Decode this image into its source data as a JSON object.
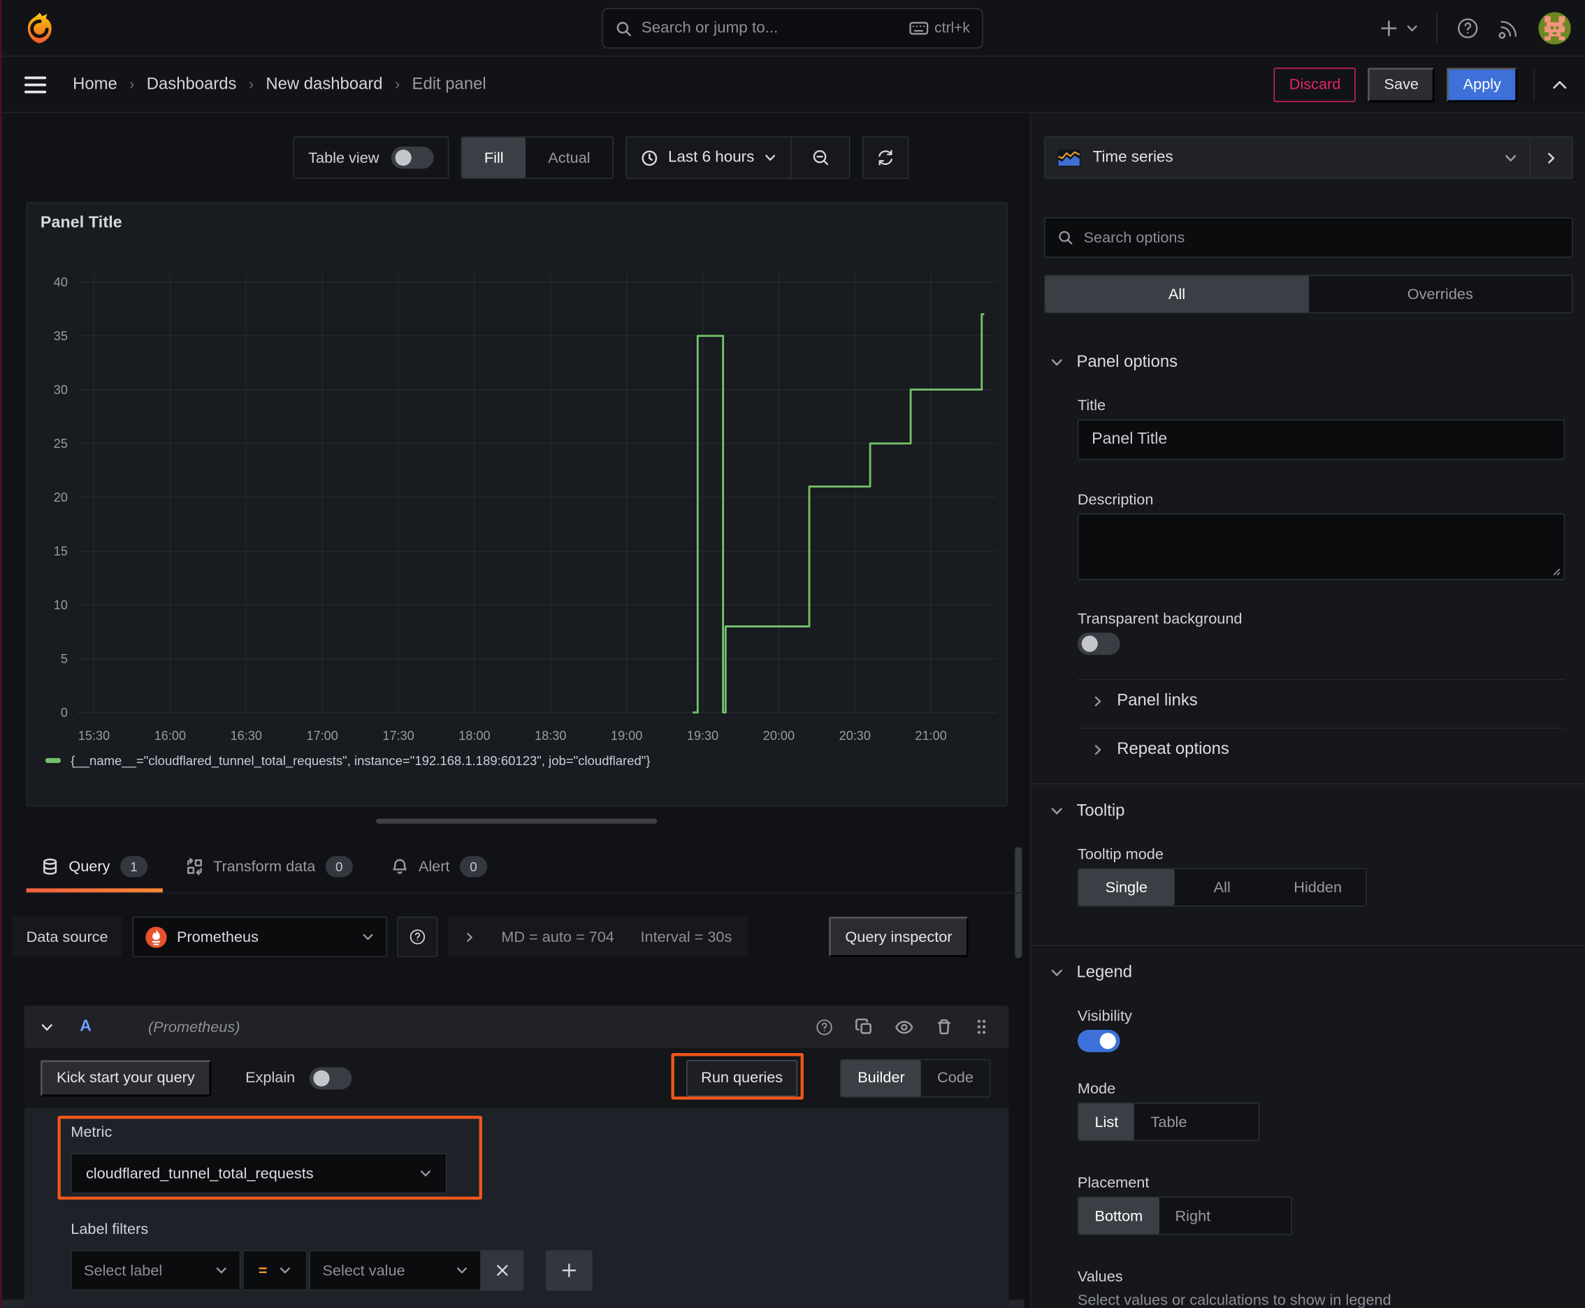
{
  "colors": {
    "primary_blue": "#3D71D9",
    "series_green": "#73BF69",
    "annotation_orange": "#F0571C",
    "discard_pink": "#E0226E",
    "operator_orange": "#FF9830"
  },
  "topbar": {
    "search_placeholder": "Search or jump to...",
    "search_shortcut": "ctrl+k"
  },
  "breadcrumb": {
    "home": "Home",
    "dashboards": "Dashboards",
    "dashboard": "New dashboard",
    "current": "Edit panel"
  },
  "header_actions": {
    "discard": "Discard",
    "save": "Save",
    "apply": "Apply"
  },
  "toolbar": {
    "table_view_label": "Table view",
    "display_modes": [
      "Fill",
      "Actual"
    ],
    "selected_display": "Fill",
    "time_range": "Last 6 hours"
  },
  "panel": {
    "title": "Panel Title"
  },
  "chart_data": {
    "type": "line",
    "style": "step-line",
    "title": "Panel Title",
    "series": [
      {
        "name": "{__name__=\"cloudflared_tunnel_total_requests\", instance=\"192.168.1.189:60123\", job=\"cloudflared\"}",
        "color": "#73BF69",
        "points": [
          [
            "19:26",
            0
          ],
          [
            "19:28",
            0
          ],
          [
            "19:28",
            35
          ],
          [
            "19:38",
            35
          ],
          [
            "19:38",
            0
          ],
          [
            "19:39",
            0
          ],
          [
            "19:39",
            8
          ],
          [
            "20:12",
            8
          ],
          [
            "20:12",
            21
          ],
          [
            "20:36",
            21
          ],
          [
            "20:36",
            25
          ],
          [
            "20:52",
            25
          ],
          [
            "20:52",
            30
          ],
          [
            "21:20",
            30
          ],
          [
            "21:20",
            37
          ],
          [
            "21:21",
            37
          ]
        ]
      }
    ],
    "x_ticks": [
      "15:30",
      "16:00",
      "16:30",
      "17:00",
      "17:30",
      "18:00",
      "18:30",
      "19:00",
      "19:30",
      "20:00",
      "20:30",
      "21:00"
    ],
    "y_ticks": [
      0,
      5,
      10,
      15,
      20,
      25,
      30,
      35,
      40
    ],
    "ylim": [
      0,
      40
    ],
    "x_range": [
      "15:23",
      "21:24"
    ],
    "grid": true,
    "legend_position": "bottom"
  },
  "query_section": {
    "tabs": [
      {
        "label": "Query",
        "badge": "1"
      },
      {
        "label": "Transform data",
        "badge": "0"
      },
      {
        "label": "Alert",
        "badge": "0"
      }
    ],
    "datasource_label": "Data source",
    "datasource_name": "Prometheus",
    "stats_md": "MD = auto = 704",
    "stats_interval": "Interval = 30s",
    "query_inspector": "Query inspector",
    "row_ref": "A",
    "row_hint": "(Prometheus)",
    "kick_start": "Kick start your query",
    "explain_label": "Explain",
    "run_queries": "Run queries",
    "editor_modes": [
      "Builder",
      "Code"
    ],
    "selected_editor": "Builder",
    "metric_label": "Metric",
    "metric_value": "cloudflared_tunnel_total_requests",
    "label_filters_label": "Label filters",
    "select_label_placeholder": "Select label",
    "operator": "=",
    "select_value_placeholder": "Select value"
  },
  "viz_picker": {
    "name": "Time series"
  },
  "options_pane": {
    "search_placeholder": "Search options",
    "tabs": [
      "All",
      "Overrides"
    ],
    "selected_tab": "All",
    "panel_options": {
      "header": "Panel options",
      "title_label": "Title",
      "title_value": "Panel Title",
      "description_label": "Description",
      "description_value": "",
      "transparent_label": "Transparent background",
      "panel_links": "Panel links",
      "repeat_options": "Repeat options"
    },
    "tooltip": {
      "header": "Tooltip",
      "mode_label": "Tooltip mode",
      "modes": [
        "Single",
        "All",
        "Hidden"
      ],
      "selected_mode": "Single"
    },
    "legend": {
      "header": "Legend",
      "visibility_label": "Visibility",
      "mode_label": "Mode",
      "modes": [
        "List",
        "Table"
      ],
      "selected_mode": "List",
      "placement_label": "Placement",
      "placements": [
        "Bottom",
        "Right"
      ],
      "selected_placement": "Bottom",
      "values_label": "Values",
      "values_description": "Select values or calculations to show in legend"
    }
  }
}
